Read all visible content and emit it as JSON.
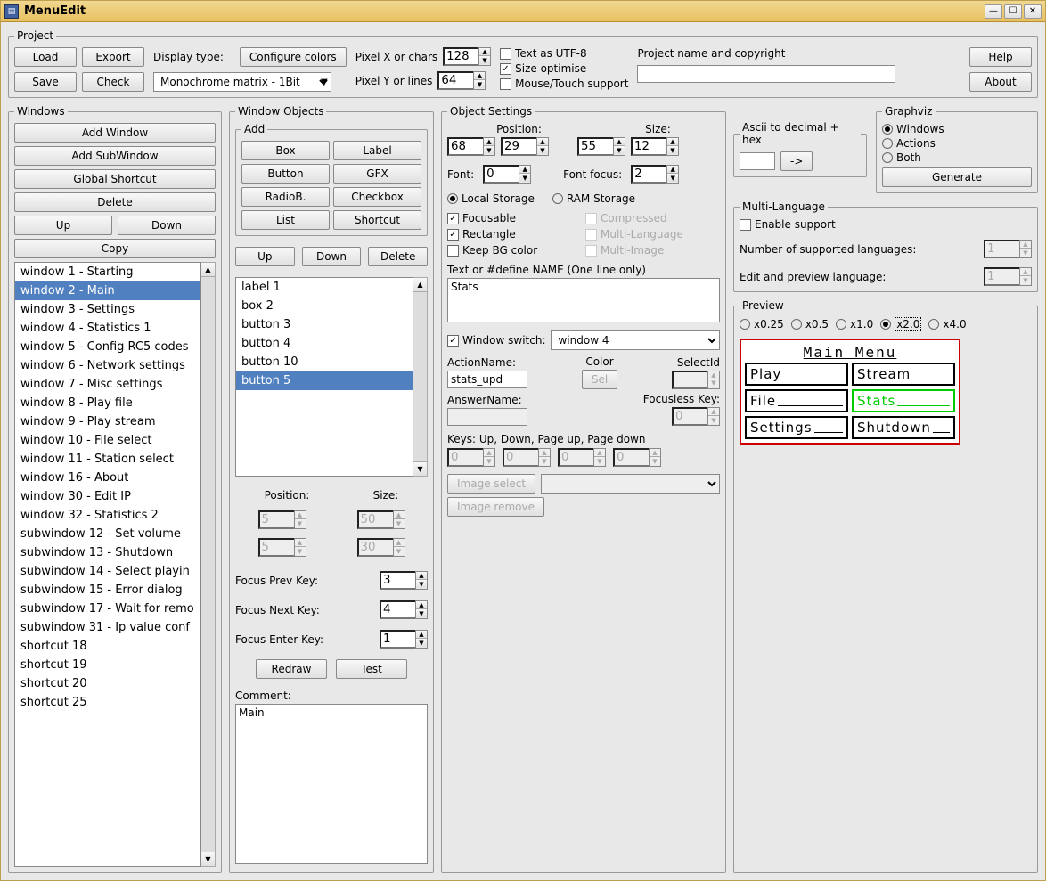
{
  "title": "MenuEdit",
  "project": {
    "legend": "Project",
    "load": "Load",
    "export": "Export",
    "save": "Save",
    "check": "Check",
    "display_type_label": "Display type:",
    "configure_colors": "Configure colors",
    "display_type_value": "Monochrome matrix - 1Bit",
    "pixel_x_label": "Pixel X or chars",
    "pixel_x": "128",
    "pixel_y_label": "Pixel Y or lines",
    "pixel_y": "64",
    "utf8": "Text as UTF-8",
    "size_opt": "Size optimise",
    "mouse": "Mouse/Touch support",
    "name_label": "Project name and copyright",
    "name_value": "",
    "help": "Help",
    "about": "About"
  },
  "windows": {
    "legend": "Windows",
    "add_window": "Add Window",
    "add_sub": "Add SubWindow",
    "global_shortcut": "Global Shortcut",
    "delete": "Delete",
    "up": "Up",
    "down": "Down",
    "copy": "Copy",
    "items": [
      "window 1 - Starting",
      "window 2 - Main",
      "window 3 - Settings",
      "window 4 - Statistics 1",
      "window 5 - Config RC5 codes",
      "window 6 - Network settings",
      "window 7 - Misc settings",
      "window 8 - Play file",
      "window 9 - Play stream",
      "window 10 - File select",
      "window 11 - Station select",
      "window 16 - About",
      "window 30 - Edit IP",
      "window 32 - Statistics 2",
      "subwindow 12 - Set volume",
      "subwindow 13 - Shutdown",
      "subwindow 14 - Select playin",
      "subwindow 15 - Error dialog",
      "subwindow 17 - Wait for remo",
      "subwindow 31 - Ip value conf",
      "shortcut 18",
      "shortcut 19",
      "shortcut 20",
      "shortcut 25"
    ],
    "selected_index": 1
  },
  "objects": {
    "legend": "Window Objects",
    "add_legend": "Add",
    "box": "Box",
    "label": "Label",
    "button": "Button",
    "gfx": "GFX",
    "radiob": "RadioB.",
    "checkbox": "Checkbox",
    "list": "List",
    "shortcut": "Shortcut",
    "up": "Up",
    "down": "Down",
    "delete": "Delete",
    "items": [
      "label 1",
      "box 2",
      "button 3",
      "button 4",
      "button 10",
      "button 5"
    ],
    "selected_index": 5,
    "position_label": "Position:",
    "size_label": "Size:",
    "pos_x": "5",
    "pos_y": "5",
    "sz_w": "50",
    "sz_h": "30",
    "focus_prev_label": "Focus Prev Key:",
    "focus_prev": "3",
    "focus_next_label": "Focus Next Key:",
    "focus_next": "4",
    "focus_enter_label": "Focus Enter Key:",
    "focus_enter": "1",
    "redraw": "Redraw",
    "test": "Test",
    "comment_label": "Comment:",
    "comment": "Main"
  },
  "settings": {
    "legend": "Object Settings",
    "position_label": "Position:",
    "size_label": "Size:",
    "pos_x": "68",
    "pos_y": "29",
    "sz_w": "55",
    "sz_h": "12",
    "font_label": "Font:",
    "font": "0",
    "font_focus_label": "Font focus:",
    "font_focus": "2",
    "local_storage": "Local Storage",
    "ram_storage": "RAM Storage",
    "focusable": "Focusable",
    "compressed": "Compressed",
    "rectangle": "Rectangle",
    "multi_lang": "Multi-Language",
    "keep_bg": "Keep BG color",
    "multi_img": "Multi-Image",
    "text_label": "Text or #define NAME (One line only)",
    "text_value": "Stats",
    "win_switch_label": "Window switch:",
    "win_switch_value": "window 4",
    "action_label": "ActionName:",
    "action_value": "stats_upd",
    "color_label": "Color",
    "color_btn": "Sel",
    "selectid_label": "SelectId",
    "selectid_value": "",
    "answer_label": "AnswerName:",
    "answer_value": "",
    "focusless_label": "Focusless Key:",
    "focusless_value": "0",
    "keys_label": "Keys: Up, Down, Page up, Page down",
    "key_up": "0",
    "key_down": "0",
    "key_pgup": "0",
    "key_pgdn": "0",
    "image_select": "Image select",
    "image_remove": "Image remove"
  },
  "ascii": {
    "legend": "Ascii to decimal + hex",
    "btn": "->"
  },
  "graphviz": {
    "legend": "Graphviz",
    "windows": "Windows",
    "actions": "Actions",
    "both": "Both",
    "generate": "Generate"
  },
  "mlang": {
    "legend": "Multi-Language",
    "enable": "Enable support",
    "num_label": "Number of supported languages:",
    "num": "1",
    "edit_label": "Edit and preview language:",
    "edit": "1"
  },
  "preview": {
    "legend": "Preview",
    "x025": "x0.25",
    "x05": "x0.5",
    "x10": "x1.0",
    "x20": "x2.0",
    "x40": "x4.0",
    "title": "Main Menu",
    "buttons": [
      "Play",
      "Stream",
      "File",
      "Stats",
      "Settings",
      "Shutdown"
    ],
    "focus_index": 3
  }
}
